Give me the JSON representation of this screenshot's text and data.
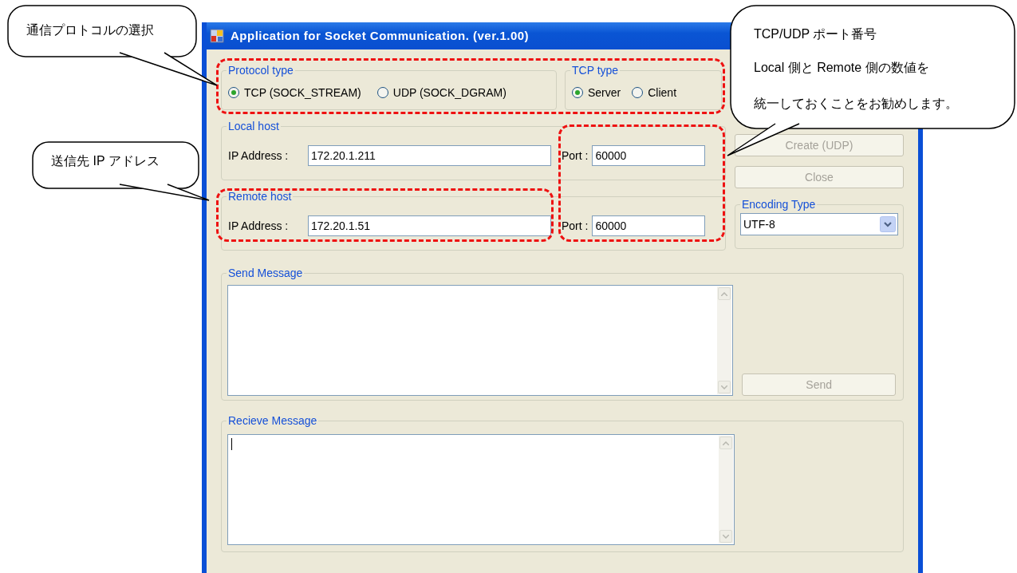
{
  "window": {
    "title": "Application for Socket Communication. (ver.1.00)"
  },
  "protocol_type": {
    "label": "Protocol type",
    "options": [
      {
        "label": "TCP (SOCK_STREAM)",
        "selected": true
      },
      {
        "label": "UDP (SOCK_DGRAM)",
        "selected": false
      }
    ]
  },
  "tcp_type": {
    "label": "TCP type",
    "options": [
      {
        "label": "Server",
        "selected": true
      },
      {
        "label": "Client",
        "selected": false
      }
    ]
  },
  "local_host": {
    "label": "Local host",
    "ip_label": "IP Address :",
    "ip": "172.20.1.211",
    "port_label": "Port :",
    "port": "60000"
  },
  "remote_host": {
    "label": "Remote host",
    "ip_label": "IP Address :",
    "ip": "172.20.1.51",
    "port_label": "Port :",
    "port": "60000"
  },
  "buttons": [
    {
      "label": "Create (UDP)",
      "disabled": true
    },
    {
      "label": "Close",
      "disabled": true
    }
  ],
  "encoding": {
    "label": "Encoding Type",
    "value": "UTF-8"
  },
  "send_message": {
    "label": "Send Message",
    "button": {
      "label": "Send",
      "disabled": true
    }
  },
  "receive_message": {
    "label": "Recieve Message"
  },
  "callouts": [
    {
      "lines": [
        "通信プロトコルの選択"
      ]
    },
    {
      "lines": [
        "送信先 IP アドレス"
      ]
    },
    {
      "lines": [
        "TCP/UDP ポート番号",
        "Local 側と Remote 側の数値を",
        "統一しておくことをお勧めします。"
      ]
    }
  ]
}
